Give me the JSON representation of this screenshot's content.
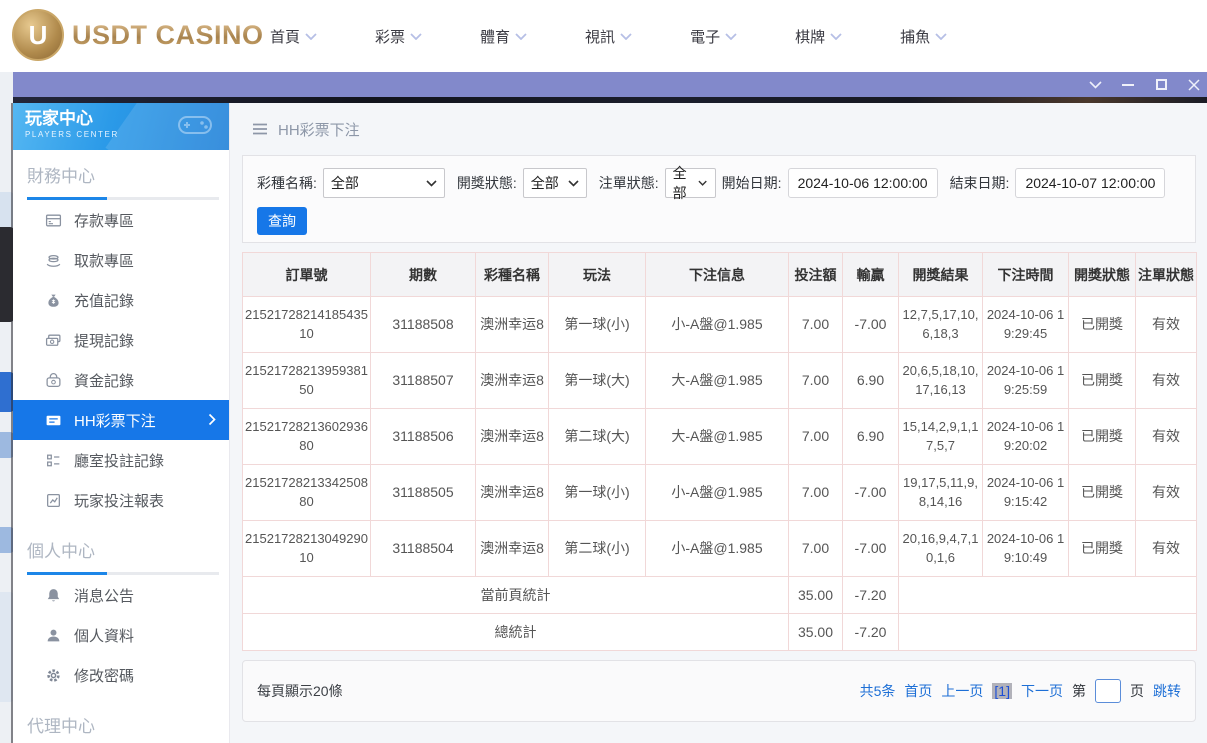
{
  "topbar": {
    "logo_badge": "U",
    "logo_text": "USDT CASINO",
    "nav": [
      {
        "label": "首頁"
      },
      {
        "label": "彩票"
      },
      {
        "label": "體育"
      },
      {
        "label": "視訊"
      },
      {
        "label": "電子"
      },
      {
        "label": "棋牌"
      },
      {
        "label": "捕魚"
      }
    ]
  },
  "sidebar": {
    "title": "玩家中心",
    "subtitle": "PLAYERS CENTER",
    "sections": [
      {
        "title": "財務中心",
        "items": [
          {
            "label": "存款專區",
            "icon": "deposit-icon",
            "active": false
          },
          {
            "label": "取款專區",
            "icon": "withdraw-icon",
            "active": false
          },
          {
            "label": "充值記錄",
            "icon": "recharge-record-icon",
            "active": false
          },
          {
            "label": "提現記錄",
            "icon": "cashout-record-icon",
            "active": false
          },
          {
            "label": "資金記錄",
            "icon": "funds-record-icon",
            "active": false
          },
          {
            "label": "HH彩票下注",
            "icon": "lottery-ticket-icon",
            "active": true
          },
          {
            "label": "廳室投註記錄",
            "icon": "hall-record-icon",
            "active": false
          },
          {
            "label": "玩家投注報表",
            "icon": "report-icon",
            "active": false
          }
        ]
      },
      {
        "title": "個人中心",
        "items": [
          {
            "label": "消息公告",
            "icon": "bell-icon",
            "active": false
          },
          {
            "label": "個人資料",
            "icon": "person-icon",
            "active": false
          },
          {
            "label": "修改密碼",
            "icon": "gear-icon",
            "active": false
          }
        ]
      },
      {
        "title": "代理中心",
        "items": []
      }
    ]
  },
  "main": {
    "page_title": "HH彩票下注",
    "filters": {
      "lottery_label": "彩種名稱:",
      "lottery_value": "全部",
      "draw_status_label": "開獎狀態:",
      "draw_status_value": "全部",
      "order_status_label": "注單狀態:",
      "order_status_value": "全部",
      "start_label": "開始日期:",
      "start_value": "2024-10-06 12:00:00",
      "end_label": "結束日期:",
      "end_value": "2024-10-07 12:00:00",
      "search_button": "查詢"
    },
    "table": {
      "headers": [
        "訂單號",
        "期數",
        "彩種名稱",
        "玩法",
        "下注信息",
        "投注額",
        "輸贏",
        "開獎結果",
        "下注時間",
        "開獎狀態",
        "注單狀態"
      ],
      "rows": [
        [
          "2152172821418543510",
          "31188508",
          "澳洲幸运8",
          "第一球(小)",
          "小-A盤@1.985",
          "7.00",
          "-7.00",
          "12,7,5,17,10,6,18,3",
          "2024-10-06 19:29:45",
          "已開獎",
          "有效"
        ],
        [
          "2152172821395938150",
          "31188507",
          "澳洲幸运8",
          "第一球(大)",
          "大-A盤@1.985",
          "7.00",
          "6.90",
          "20,6,5,18,10,17,16,13",
          "2024-10-06 19:25:59",
          "已開獎",
          "有效"
        ],
        [
          "2152172821360293680",
          "31188506",
          "澳洲幸运8",
          "第二球(大)",
          "大-A盤@1.985",
          "7.00",
          "6.90",
          "15,14,2,9,1,17,5,7",
          "2024-10-06 19:20:02",
          "已開獎",
          "有效"
        ],
        [
          "2152172821334250880",
          "31188505",
          "澳洲幸运8",
          "第一球(小)",
          "小-A盤@1.985",
          "7.00",
          "-7.00",
          "19,17,5,11,9,8,14,16",
          "2024-10-06 19:15:42",
          "已開獎",
          "有效"
        ],
        [
          "2152172821304929010",
          "31188504",
          "澳洲幸运8",
          "第二球(小)",
          "小-A盤@1.985",
          "7.00",
          "-7.00",
          "20,16,9,4,7,10,1,6",
          "2024-10-06 19:10:49",
          "已開獎",
          "有效"
        ]
      ],
      "summary": [
        {
          "label": "當前頁統計",
          "bet_total": "35.00",
          "winloss_total": "-7.20"
        },
        {
          "label": "總統計",
          "bet_total": "35.00",
          "winloss_total": "-7.20"
        }
      ]
    },
    "footer": {
      "page_size_text": "每頁顯示20條",
      "total_text": "共5条",
      "first_page": "首页",
      "prev_page": "上一页",
      "current_page": "[1]",
      "next_page": "下一页",
      "jump_prefix": "第",
      "jump_value": "",
      "jump_suffix": "页",
      "jump_action": "跳转"
    }
  },
  "colors": {
    "accent_blue": "#1677e8",
    "titlebar_purple": "#8289cb",
    "sidebar_gradient_start": "#55b7f2",
    "sidebar_gradient_end": "#1d7fd8",
    "table_border_pink": "#f1d8d8",
    "link_blue": "#1d6fd6",
    "logo_gold": "#b8935a"
  }
}
